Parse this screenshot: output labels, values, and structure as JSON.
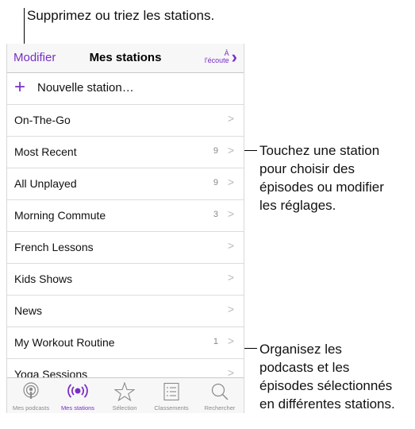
{
  "callouts": {
    "top": "Supprimez ou triez les stations.",
    "right1": [
      "Touchez une station",
      "pour choisir des",
      "épisodes ou modifier",
      "les réglages."
    ],
    "right2": [
      "Organisez les",
      "podcasts et les",
      "épisodes sélectionnés",
      "en différentes stations."
    ]
  },
  "nav": {
    "left": "Modifier",
    "title": "Mes stations",
    "right_line1": "À",
    "right_line2": "l'écoute"
  },
  "new_station": "Nouvelle station…",
  "stations": [
    {
      "label": "On-The-Go",
      "count": ""
    },
    {
      "label": "Most Recent",
      "count": "9"
    },
    {
      "label": "All Unplayed",
      "count": "9"
    },
    {
      "label": "Morning Commute",
      "count": "3"
    },
    {
      "label": "French Lessons",
      "count": ""
    },
    {
      "label": "Kids Shows",
      "count": ""
    },
    {
      "label": "News",
      "count": ""
    },
    {
      "label": "My Workout Routine",
      "count": "1"
    },
    {
      "label": "Yoga Sessions",
      "count": ""
    }
  ],
  "tabs": [
    {
      "label": "Mes podcasts",
      "icon": "podcast-icon"
    },
    {
      "label": "Mes stations",
      "icon": "stations-icon"
    },
    {
      "label": "Sélection",
      "icon": "star-icon"
    },
    {
      "label": "Classements",
      "icon": "list-icon"
    },
    {
      "label": "Rechercher",
      "icon": "search-icon"
    }
  ],
  "colors": {
    "accent": "#7a2ec6",
    "chevron": "#b8b8b8",
    "count": "#888888"
  }
}
